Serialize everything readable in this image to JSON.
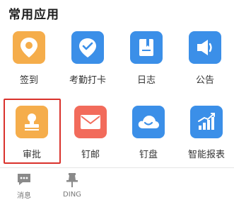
{
  "section": {
    "title": "常用应用"
  },
  "apps": [
    {
      "label": "签到",
      "icon": "location-pin-icon",
      "color": "#f5ad4b"
    },
    {
      "label": "考勤打卡",
      "icon": "clock-check-icon",
      "color": "#3b8fe8"
    },
    {
      "label": "日志",
      "icon": "notebook-icon",
      "color": "#3b8fe8"
    },
    {
      "label": "公告",
      "icon": "megaphone-icon",
      "color": "#3b8fe8"
    },
    {
      "label": "审批",
      "icon": "stamp-icon",
      "color": "#f5ad4b"
    },
    {
      "label": "钉邮",
      "icon": "envelope-icon",
      "color": "#f26b5b"
    },
    {
      "label": "钉盘",
      "icon": "cloud-icon",
      "color": "#3b8fe8"
    },
    {
      "label": "智能报表",
      "icon": "bar-chart-icon",
      "color": "#3b8fe8"
    }
  ],
  "tabs": [
    {
      "label": "消息",
      "icon": "chat-bubble-icon"
    },
    {
      "label": "DING",
      "icon": "pin-icon"
    }
  ],
  "colors": {
    "highlight": "#d9322c",
    "accent_blue": "#3b8fe8",
    "accent_orange": "#f5ad4b",
    "accent_red": "#f26b5b"
  }
}
